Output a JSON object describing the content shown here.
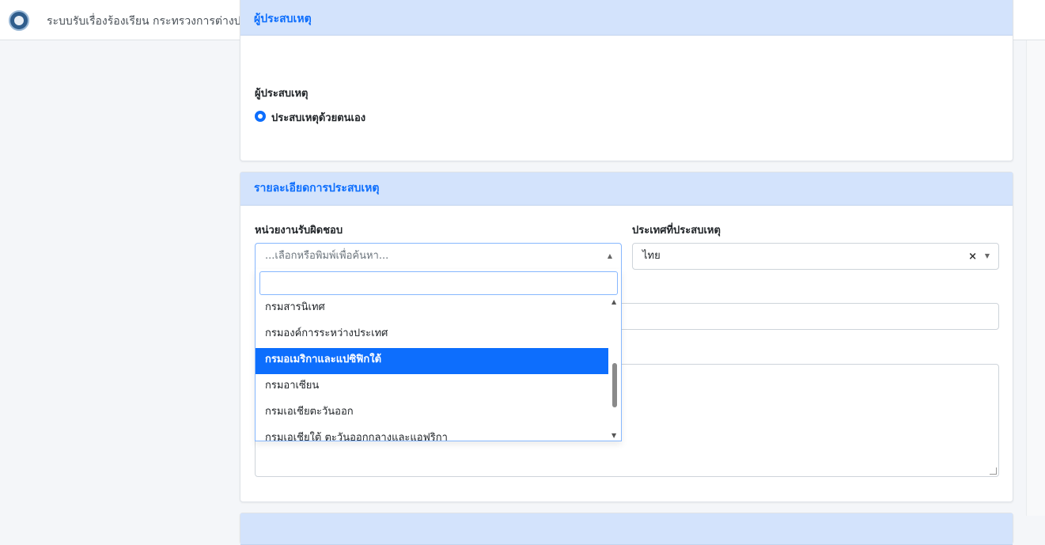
{
  "header": {
    "app_title": "ระบบรับเรื่องร้องเรียน กระทรวงการต่างประเทศ",
    "logo_icon": "ministry-seal-icon"
  },
  "reporter_section": {
    "title": "ผู้ประสบเหตุ",
    "field_label": "ผู้ประสบเหตุ",
    "radio_option": "ประสบเหตุด้วยตนเอง",
    "radio_selected": true
  },
  "incident_section": {
    "title": "รายละเอียดการประสบเหตุ",
    "agency_label": "หน่วยงานรับผิดชอบ",
    "agency_placeholder": "...เลือกหรือพิมพ์เพื่อค้นหา...",
    "country_label": "ประเทศที่ประสบเหตุ",
    "country_value": "ไทย",
    "country_clear": "×"
  },
  "agency_dropdown": {
    "search_value": "",
    "options": [
      "กรมสารนิเทศ",
      "กรมองค์การระหว่างประเทศ",
      "กรมอเมริกาและแปซิฟิกใต้",
      "กรมอาเซียน",
      "กรมเอเชียตะวันออก",
      "กรมเอเชียใต้ ตะวันออกกลางและแอฟริกา"
    ],
    "highlighted": "กรมอเมริกาและแปซิฟิกใต้"
  },
  "colors": {
    "accent": "#0d6efd",
    "section_header_bg": "#d3e3fc"
  }
}
